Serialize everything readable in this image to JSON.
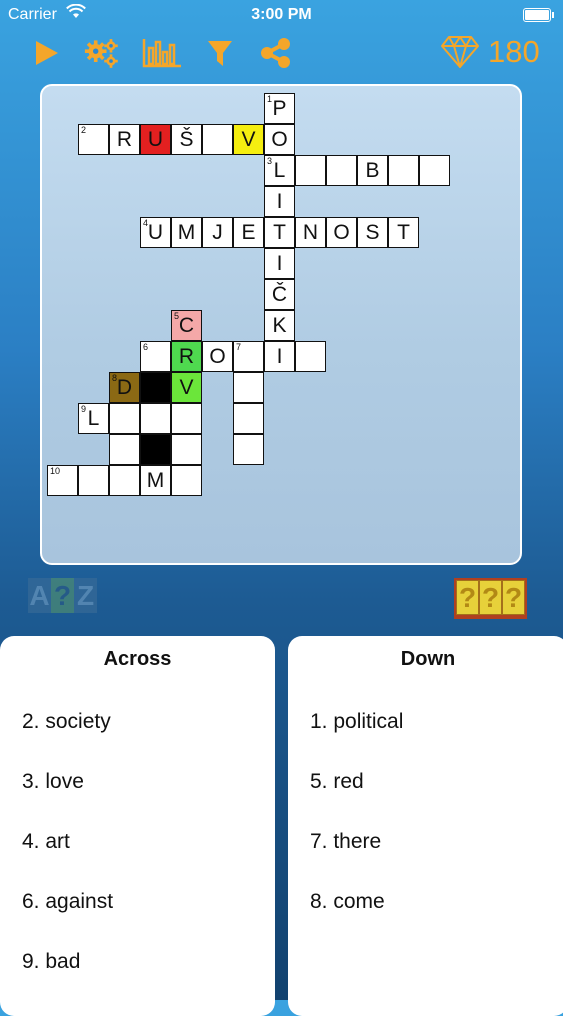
{
  "status": {
    "carrier": "Carrier",
    "time": "3:00 PM"
  },
  "toolbar": {
    "icons": [
      "play-icon",
      "settings-gears-icon",
      "stats-chart-icon",
      "filter-icon",
      "share-icon"
    ],
    "accent_color": "#f4a62a",
    "score": "180"
  },
  "hints": {
    "az": {
      "a": "A",
      "q": "?",
      "z": "Z"
    },
    "q1": "?",
    "q2": "?",
    "q3": "?"
  },
  "grid": {
    "cells": [
      {
        "r": 0,
        "c": 7,
        "letter": "P",
        "num": "1"
      },
      {
        "r": 1,
        "c": 1,
        "letter": "",
        "num": "2"
      },
      {
        "r": 1,
        "c": 2,
        "letter": "R"
      },
      {
        "r": 1,
        "c": 3,
        "letter": "U",
        "color": "#e32020"
      },
      {
        "r": 1,
        "c": 4,
        "letter": "Š"
      },
      {
        "r": 1,
        "c": 5,
        "letter": ""
      },
      {
        "r": 1,
        "c": 6,
        "letter": "V",
        "color": "#f5ee10"
      },
      {
        "r": 1,
        "c": 7,
        "letter": "O"
      },
      {
        "r": 2,
        "c": 7,
        "letter": "L",
        "num": "3"
      },
      {
        "r": 2,
        "c": 8,
        "letter": ""
      },
      {
        "r": 2,
        "c": 9,
        "letter": ""
      },
      {
        "r": 2,
        "c": 10,
        "letter": "B"
      },
      {
        "r": 2,
        "c": 11,
        "letter": ""
      },
      {
        "r": 2,
        "c": 12,
        "letter": ""
      },
      {
        "r": 3,
        "c": 7,
        "letter": "I"
      },
      {
        "r": 4,
        "c": 3,
        "letter": "U",
        "num": "4"
      },
      {
        "r": 4,
        "c": 4,
        "letter": "M"
      },
      {
        "r": 4,
        "c": 5,
        "letter": "J"
      },
      {
        "r": 4,
        "c": 6,
        "letter": "E"
      },
      {
        "r": 4,
        "c": 7,
        "letter": "T"
      },
      {
        "r": 4,
        "c": 8,
        "letter": "N"
      },
      {
        "r": 4,
        "c": 9,
        "letter": "O"
      },
      {
        "r": 4,
        "c": 10,
        "letter": "S"
      },
      {
        "r": 4,
        "c": 11,
        "letter": "T"
      },
      {
        "r": 5,
        "c": 7,
        "letter": "I"
      },
      {
        "r": 6,
        "c": 7,
        "letter": "Č"
      },
      {
        "r": 7,
        "c": 4,
        "letter": "C",
        "num": "5",
        "color": "#f4a8a8"
      },
      {
        "r": 7,
        "c": 7,
        "letter": "K"
      },
      {
        "r": 8,
        "c": 3,
        "letter": "",
        "num": "6"
      },
      {
        "r": 8,
        "c": 4,
        "letter": "R",
        "color": "#4fd94f"
      },
      {
        "r": 8,
        "c": 5,
        "letter": "O"
      },
      {
        "r": 8,
        "c": 6,
        "letter": "",
        "num": "7"
      },
      {
        "r": 8,
        "c": 7,
        "letter": "I"
      },
      {
        "r": 8,
        "c": 8,
        "letter": ""
      },
      {
        "r": 9,
        "c": 2,
        "letter": "D",
        "num": "8",
        "color": "#8b6914"
      },
      {
        "r": 9,
        "c": 3,
        "letter": "",
        "color": "#000000"
      },
      {
        "r": 9,
        "c": 4,
        "letter": "V",
        "color": "#6be63a"
      },
      {
        "r": 9,
        "c": 6,
        "letter": ""
      },
      {
        "r": 10,
        "c": 1,
        "letter": "L",
        "num": "9"
      },
      {
        "r": 10,
        "c": 2,
        "letter": ""
      },
      {
        "r": 10,
        "c": 3,
        "letter": ""
      },
      {
        "r": 10,
        "c": 4,
        "letter": ""
      },
      {
        "r": 10,
        "c": 6,
        "letter": ""
      },
      {
        "r": 11,
        "c": 2,
        "letter": ""
      },
      {
        "r": 11,
        "c": 3,
        "letter": "",
        "color": "#000000"
      },
      {
        "r": 11,
        "c": 4,
        "letter": ""
      },
      {
        "r": 11,
        "c": 6,
        "letter": ""
      },
      {
        "r": 12,
        "c": 0,
        "letter": "",
        "num": "10"
      },
      {
        "r": 12,
        "c": 1,
        "letter": ""
      },
      {
        "r": 12,
        "c": 2,
        "letter": ""
      },
      {
        "r": 12,
        "c": 3,
        "letter": "M"
      },
      {
        "r": 12,
        "c": 4,
        "letter": ""
      }
    ]
  },
  "across": {
    "title": "Across",
    "clues": [
      "2. society",
      "3. love",
      "4. art",
      "6. against",
      "9. bad"
    ]
  },
  "down": {
    "title": "Down",
    "clues": [
      "1. political",
      "5. red",
      "7. there",
      "8. come"
    ]
  }
}
